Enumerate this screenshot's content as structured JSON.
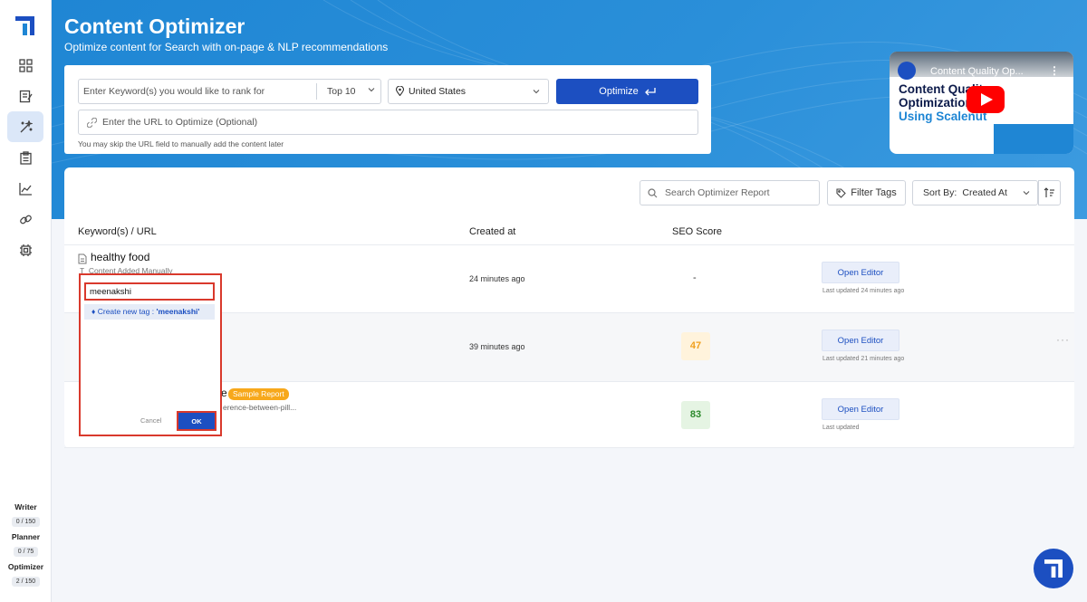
{
  "app": {
    "title": "Content Optimizer",
    "subtitle": "Optimize content for Search with on-page & NLP recommendations"
  },
  "sidebar": {
    "nav": [
      {
        "icon": "dashboard-icon"
      },
      {
        "icon": "edit-document-icon"
      },
      {
        "icon": "magic-wand-icon",
        "active": true
      },
      {
        "icon": "clipboard-icon"
      },
      {
        "icon": "chart-icon"
      },
      {
        "icon": "link-icon"
      },
      {
        "icon": "chip-icon"
      }
    ],
    "usage": [
      {
        "label": "Writer",
        "value": "0 / 150"
      },
      {
        "label": "Planner",
        "value": "0 / 75"
      },
      {
        "label": "Optimizer",
        "value": "2 / 150"
      }
    ]
  },
  "form": {
    "keyword_placeholder": "Enter Keyword(s) you would like to rank for",
    "top_select": "Top 10",
    "country": "United States",
    "optimize_label": "Optimize",
    "url_placeholder": "Enter the URL to Optimize (Optional)",
    "hint": "You may skip the URL field to manually add the content later"
  },
  "video": {
    "title": "Content Quality Op...",
    "line1": "Content Quality",
    "line2": "Optimization",
    "line3": "Using Scalenut"
  },
  "toolbar": {
    "search_placeholder": "Search Optimizer Report",
    "filter_label": "Filter Tags",
    "sort_label": "Sort By:",
    "sort_value": "Created At"
  },
  "table": {
    "columns": [
      "Keyword(s) / URL",
      "Created at",
      "SEO Score"
    ],
    "rows": [
      {
        "keyword": "healthy food",
        "sub": "Content Added Manually",
        "created": "24 minutes ago",
        "score": "-",
        "action": "Open Editor",
        "updated": "Last updated 24 minutes ago"
      },
      {
        "keyword": "",
        "sub": "",
        "created": "39 minutes ago",
        "score": "47",
        "action": "Open Editor",
        "updated": "Last updated 21 minutes ago",
        "menu": "···"
      },
      {
        "keyword": "e",
        "badge": "Sample Report",
        "sub": "erence-between-pill...",
        "created": "",
        "score": "83",
        "action": "Open Editor",
        "updated": "Last updated"
      }
    ]
  },
  "popup": {
    "tag_value": "meenakshi",
    "create_prefix": "Create new tag : ",
    "create_tag": "'meenakshi'",
    "cancel_label": "Cancel",
    "ok_label": "OK"
  },
  "colors": {
    "primary": "#1c4fc1",
    "header": "#1f86d4",
    "highlight": "#d9392c",
    "sample_badge": "#f7a81b"
  }
}
